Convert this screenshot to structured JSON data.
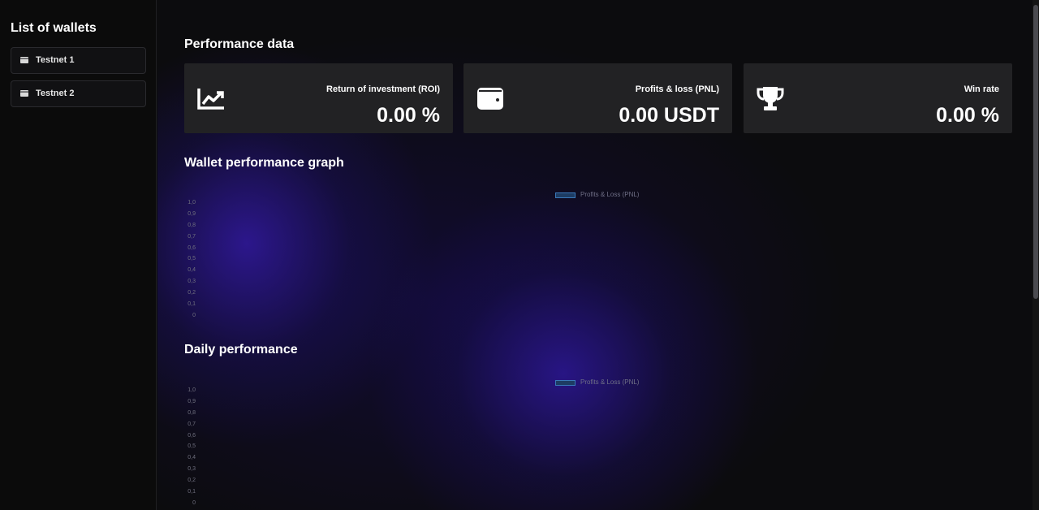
{
  "sidebar": {
    "title": "List of wallets",
    "wallets": [
      {
        "label": "Testnet 1",
        "icon": "wallet-icon"
      },
      {
        "label": "Testnet 2",
        "icon": "wallet-icon"
      }
    ]
  },
  "performance": {
    "title": "Performance data",
    "cards": [
      {
        "icon": "chart-line-icon",
        "label": "Return of investment (ROI)",
        "value": "0.00 %"
      },
      {
        "icon": "wallet-icon",
        "label": "Profits & loss (PNL)",
        "value": "0.00 USDT"
      },
      {
        "icon": "trophy-icon",
        "label": "Win rate",
        "value": "0.00 %"
      }
    ]
  },
  "graph": {
    "title": "Wallet performance graph",
    "legend": "Profits & Loss (PNL)",
    "ticks": [
      "1,0",
      "0,9",
      "0,8",
      "0,7",
      "0,6",
      "0,5",
      "0,4",
      "0,3",
      "0,2",
      "0,1",
      "0"
    ]
  },
  "daily": {
    "title": "Daily performance",
    "legend": "Profits & Loss (PNL)",
    "ticks": [
      "1,0",
      "0,9",
      "0,8",
      "0,7",
      "0,6",
      "0,5",
      "0,4",
      "0,3",
      "0,2",
      "0,1",
      "0"
    ]
  },
  "colors": {
    "background": "#0c0c0e",
    "card": "#222224",
    "accent_glow": "#341aaa",
    "legend_fill": "#1d3c63",
    "legend_border": "#3a78b8"
  }
}
